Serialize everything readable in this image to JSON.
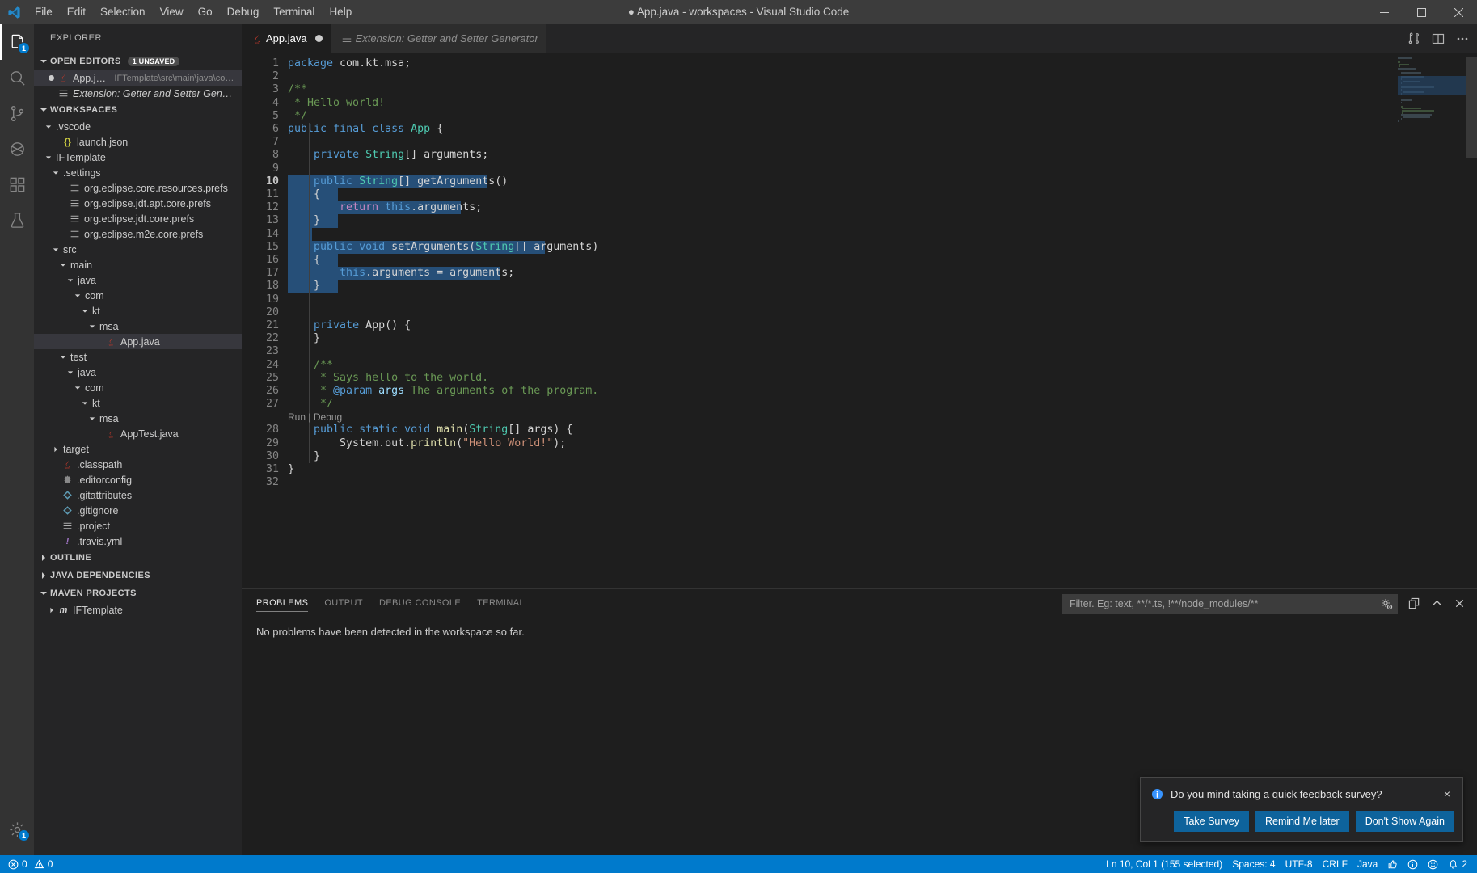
{
  "titlebar": {
    "app_icon": "vscode-logo-icon",
    "menus": [
      "File",
      "Edit",
      "Selection",
      "View",
      "Go",
      "Debug",
      "Terminal",
      "Help"
    ],
    "window_title": "● App.java - workspaces - Visual Studio Code",
    "controls": {
      "minimize": "minimize-icon",
      "maximize": "maximize-icon",
      "close": "close-icon"
    }
  },
  "activitybar": {
    "items": [
      {
        "name": "explorer",
        "icon": "files-icon",
        "active": true,
        "badge": "1"
      },
      {
        "name": "search",
        "icon": "search-icon",
        "active": false,
        "badge": ""
      },
      {
        "name": "source-control",
        "icon": "source-control-icon",
        "active": false,
        "badge": ""
      },
      {
        "name": "debug",
        "icon": "debug-icon",
        "active": false,
        "badge": ""
      },
      {
        "name": "extensions",
        "icon": "extensions-icon",
        "active": false,
        "badge": ""
      },
      {
        "name": "testing",
        "icon": "beaker-icon",
        "active": false,
        "badge": ""
      }
    ],
    "bottom": [
      {
        "name": "manage",
        "icon": "gear-icon",
        "badge": "1"
      }
    ]
  },
  "sidebar": {
    "title": "EXPLORER",
    "open_editors": {
      "label": "OPEN EDITORS",
      "badge": "1 UNSAVED",
      "expanded": true,
      "items": [
        {
          "label": "App.java",
          "sublabel": "IFTemplate\\src\\main\\java\\com\\kt\\...",
          "icon": "java-icon",
          "dirty": true,
          "selected": true,
          "italic": false
        },
        {
          "label": "Extension: Getter and Setter Generator",
          "sublabel": "",
          "icon": "settings-file-icon",
          "dirty": false,
          "selected": false,
          "italic": true
        }
      ]
    },
    "workspaces": {
      "label": "WORKSPACES",
      "expanded": true,
      "tree": [
        {
          "label": ".vscode",
          "depth": 1,
          "kind": "folder",
          "state": "expanded"
        },
        {
          "label": "launch.json",
          "depth": 2,
          "kind": "json"
        },
        {
          "label": "IFTemplate",
          "depth": 1,
          "kind": "folder",
          "state": "expanded"
        },
        {
          "label": ".settings",
          "depth": 2,
          "kind": "folder",
          "state": "expanded"
        },
        {
          "label": "org.eclipse.core.resources.prefs",
          "depth": 3,
          "kind": "prefs"
        },
        {
          "label": "org.eclipse.jdt.apt.core.prefs",
          "depth": 3,
          "kind": "prefs"
        },
        {
          "label": "org.eclipse.jdt.core.prefs",
          "depth": 3,
          "kind": "prefs"
        },
        {
          "label": "org.eclipse.m2e.core.prefs",
          "depth": 3,
          "kind": "prefs"
        },
        {
          "label": "src",
          "depth": 2,
          "kind": "folder",
          "state": "expanded"
        },
        {
          "label": "main",
          "depth": 3,
          "kind": "folder",
          "state": "expanded"
        },
        {
          "label": "java",
          "depth": 4,
          "kind": "folder",
          "state": "expanded"
        },
        {
          "label": "com",
          "depth": 5,
          "kind": "folder",
          "state": "expanded"
        },
        {
          "label": "kt",
          "depth": 6,
          "kind": "folder",
          "state": "expanded"
        },
        {
          "label": "msa",
          "depth": 7,
          "kind": "folder",
          "state": "expanded"
        },
        {
          "label": "App.java",
          "depth": 8,
          "kind": "java",
          "selected": true
        },
        {
          "label": "test",
          "depth": 3,
          "kind": "folder",
          "state": "expanded"
        },
        {
          "label": "java",
          "depth": 4,
          "kind": "folder",
          "state": "expanded"
        },
        {
          "label": "com",
          "depth": 5,
          "kind": "folder",
          "state": "expanded"
        },
        {
          "label": "kt",
          "depth": 6,
          "kind": "folder",
          "state": "expanded"
        },
        {
          "label": "msa",
          "depth": 7,
          "kind": "folder",
          "state": "expanded"
        },
        {
          "label": "AppTest.java",
          "depth": 8,
          "kind": "java"
        },
        {
          "label": "target",
          "depth": 2,
          "kind": "folder",
          "state": "collapsed"
        },
        {
          "label": ".classpath",
          "depth": 2,
          "kind": "java"
        },
        {
          "label": ".editorconfig",
          "depth": 2,
          "kind": "gear"
        },
        {
          "label": ".gitattributes",
          "depth": 2,
          "kind": "git"
        },
        {
          "label": ".gitignore",
          "depth": 2,
          "kind": "git"
        },
        {
          "label": ".project",
          "depth": 2,
          "kind": "prefs"
        },
        {
          "label": ".travis.yml",
          "depth": 2,
          "kind": "yml"
        }
      ]
    },
    "outline": {
      "label": "OUTLINE",
      "expanded": false
    },
    "java_dependencies": {
      "label": "JAVA DEPENDENCIES",
      "expanded": false
    },
    "maven_projects": {
      "label": "MAVEN PROJECTS",
      "expanded": true,
      "items": [
        {
          "label": "IFTemplate",
          "icon": "maven-icon",
          "state": "collapsed"
        }
      ]
    }
  },
  "editor": {
    "tabs": [
      {
        "label": "App.java",
        "icon": "java-icon",
        "active": true,
        "dirty": true,
        "italic": false
      },
      {
        "label": "Extension: Getter and Setter Generator",
        "icon": "settings-file-icon",
        "active": false,
        "dirty": false,
        "italic": true
      }
    ],
    "actions": [
      {
        "name": "split-editor-icon"
      },
      {
        "name": "open-changes-icon"
      },
      {
        "name": "more-actions-icon"
      }
    ],
    "codelens": {
      "run": "Run",
      "separator": "|",
      "debug": "Debug",
      "on_line": 28
    },
    "selection_start_line": 10,
    "selection_end_line": 18,
    "lines": [
      {
        "n": 1,
        "tokens": [
          {
            "t": "package ",
            "c": "kw"
          },
          {
            "t": "com.kt.msa;",
            "c": "plain"
          }
        ]
      },
      {
        "n": 2,
        "tokens": []
      },
      {
        "n": 3,
        "tokens": [
          {
            "t": "/**",
            "c": "cmt"
          }
        ]
      },
      {
        "n": 4,
        "tokens": [
          {
            "t": " * Hello world!",
            "c": "cmt"
          }
        ]
      },
      {
        "n": 5,
        "tokens": [
          {
            "t": " */",
            "c": "cmt"
          }
        ]
      },
      {
        "n": 6,
        "tokens": [
          {
            "t": "public",
            "c": "kw"
          },
          {
            "t": " ",
            "c": "plain"
          },
          {
            "t": "final",
            "c": "kw"
          },
          {
            "t": " ",
            "c": "plain"
          },
          {
            "t": "class",
            "c": "kw"
          },
          {
            "t": " ",
            "c": "plain"
          },
          {
            "t": "App",
            "c": "type"
          },
          {
            "t": " {",
            "c": "plain"
          }
        ]
      },
      {
        "n": 7,
        "tokens": []
      },
      {
        "n": 8,
        "tokens": [
          {
            "t": "    ",
            "c": "plain"
          },
          {
            "t": "private",
            "c": "kw"
          },
          {
            "t": " ",
            "c": "plain"
          },
          {
            "t": "String",
            "c": "type"
          },
          {
            "t": "[] arguments;",
            "c": "plain"
          }
        ]
      },
      {
        "n": 9,
        "tokens": []
      },
      {
        "n": 10,
        "tokens": [
          {
            "t": "    ",
            "c": "plain"
          },
          {
            "t": "public",
            "c": "kw"
          },
          {
            "t": " ",
            "c": "plain"
          },
          {
            "t": "String",
            "c": "type"
          },
          {
            "t": "[] getArguments()",
            "c": "plain"
          }
        ]
      },
      {
        "n": 11,
        "tokens": [
          {
            "t": "    {",
            "c": "plain"
          }
        ]
      },
      {
        "n": 12,
        "tokens": [
          {
            "t": "        ",
            "c": "plain"
          },
          {
            "t": "return",
            "c": "kw2"
          },
          {
            "t": " ",
            "c": "plain"
          },
          {
            "t": "this",
            "c": "kw"
          },
          {
            "t": ".arguments;",
            "c": "plain"
          }
        ]
      },
      {
        "n": 13,
        "tokens": [
          {
            "t": "    }",
            "c": "plain"
          }
        ]
      },
      {
        "n": 14,
        "tokens": []
      },
      {
        "n": 15,
        "tokens": [
          {
            "t": "    ",
            "c": "plain"
          },
          {
            "t": "public",
            "c": "kw"
          },
          {
            "t": " ",
            "c": "plain"
          },
          {
            "t": "void",
            "c": "kw"
          },
          {
            "t": " setArguments(",
            "c": "plain"
          },
          {
            "t": "String",
            "c": "type"
          },
          {
            "t": "[] arguments)",
            "c": "plain"
          }
        ]
      },
      {
        "n": 16,
        "tokens": [
          {
            "t": "    {",
            "c": "plain"
          }
        ]
      },
      {
        "n": 17,
        "tokens": [
          {
            "t": "        ",
            "c": "plain"
          },
          {
            "t": "this",
            "c": "kw"
          },
          {
            "t": ".arguments = arguments;",
            "c": "plain"
          }
        ]
      },
      {
        "n": 18,
        "tokens": [
          {
            "t": "    }",
            "c": "plain"
          }
        ]
      },
      {
        "n": 19,
        "tokens": []
      },
      {
        "n": 20,
        "tokens": []
      },
      {
        "n": 21,
        "tokens": [
          {
            "t": "    ",
            "c": "plain"
          },
          {
            "t": "private",
            "c": "kw"
          },
          {
            "t": " App() {",
            "c": "plain"
          }
        ]
      },
      {
        "n": 22,
        "tokens": [
          {
            "t": "    }",
            "c": "plain"
          }
        ]
      },
      {
        "n": 23,
        "tokens": []
      },
      {
        "n": 24,
        "tokens": [
          {
            "t": "    /**",
            "c": "cmt"
          }
        ]
      },
      {
        "n": 25,
        "tokens": [
          {
            "t": "     * Says hello to the world.",
            "c": "cmt"
          }
        ]
      },
      {
        "n": 26,
        "tokens": [
          {
            "t": "     * ",
            "c": "cmt"
          },
          {
            "t": "@param",
            "c": "jdoc-tag"
          },
          {
            "t": " ",
            "c": "cmt"
          },
          {
            "t": "args",
            "c": "jdoc-param"
          },
          {
            "t": " The arguments of the program.",
            "c": "cmt"
          }
        ]
      },
      {
        "n": 27,
        "tokens": [
          {
            "t": "     */",
            "c": "cmt"
          }
        ]
      },
      {
        "n": 28,
        "tokens": [
          {
            "t": "    ",
            "c": "plain"
          },
          {
            "t": "public",
            "c": "kw"
          },
          {
            "t": " ",
            "c": "plain"
          },
          {
            "t": "static",
            "c": "kw"
          },
          {
            "t": " ",
            "c": "plain"
          },
          {
            "t": "void",
            "c": "kw"
          },
          {
            "t": " ",
            "c": "plain"
          },
          {
            "t": "main",
            "c": "fn"
          },
          {
            "t": "(",
            "c": "plain"
          },
          {
            "t": "String",
            "c": "type"
          },
          {
            "t": "[] args) {",
            "c": "plain"
          }
        ]
      },
      {
        "n": 29,
        "tokens": [
          {
            "t": "        System.out.",
            "c": "plain"
          },
          {
            "t": "println",
            "c": "fn"
          },
          {
            "t": "(",
            "c": "plain"
          },
          {
            "t": "\"Hello World!\"",
            "c": "str"
          },
          {
            "t": ");",
            "c": "plain"
          }
        ]
      },
      {
        "n": 30,
        "tokens": [
          {
            "t": "    }",
            "c": "plain"
          }
        ]
      },
      {
        "n": 31,
        "tokens": [
          {
            "t": "}",
            "c": "plain"
          }
        ]
      },
      {
        "n": 32,
        "tokens": []
      }
    ]
  },
  "panel": {
    "tabs": [
      {
        "label": "PROBLEMS",
        "active": true
      },
      {
        "label": "OUTPUT",
        "active": false
      },
      {
        "label": "DEBUG CONSOLE",
        "active": false
      },
      {
        "label": "TERMINAL",
        "active": false
      }
    ],
    "filter": {
      "value": "",
      "placeholder": "Filter. Eg: text, **/*.ts, !**/node_modules/**"
    },
    "actions": [
      {
        "name": "filter-settings-icon"
      },
      {
        "name": "clear-filters-icon"
      },
      {
        "name": "maximize-panel-icon"
      },
      {
        "name": "close-panel-icon"
      }
    ],
    "message": "No problems have been detected in the workspace so far."
  },
  "notification": {
    "icon": "info-icon",
    "message": "Do you mind taking a quick feedback survey?",
    "close": "×",
    "buttons": [
      "Take Survey",
      "Remind Me later",
      "Don't Show Again"
    ]
  },
  "statusbar": {
    "left": [
      {
        "name": "errors-warnings",
        "icon": "error-icon",
        "text": "0",
        "icon2": "warning-icon",
        "text2": "0"
      }
    ],
    "right": [
      {
        "name": "cursor-position",
        "text": "Ln 10, Col 1 (155 selected)"
      },
      {
        "name": "indentation",
        "text": "Spaces: 4"
      },
      {
        "name": "encoding",
        "text": "UTF-8"
      },
      {
        "name": "eol",
        "text": "CRLF"
      },
      {
        "name": "language-mode",
        "text": "Java"
      },
      {
        "name": "feedback-thumbsup",
        "icon": "thumbsup-icon",
        "text": ""
      },
      {
        "name": "java-status",
        "icon": "info-circle-icon",
        "text": ""
      },
      {
        "name": "tweet-feedback",
        "icon": "smiley-icon",
        "text": ""
      },
      {
        "name": "notifications",
        "icon": "bell-icon",
        "text": "2"
      }
    ]
  },
  "colors": {
    "accent": "#007acc",
    "selection": "#264f78",
    "sidebar_bg": "#252526",
    "editor_bg": "#1e1e1e",
    "titlebar_bg": "#3c3c3c",
    "activitybar_bg": "#333333",
    "button_bg": "#0e639c"
  }
}
